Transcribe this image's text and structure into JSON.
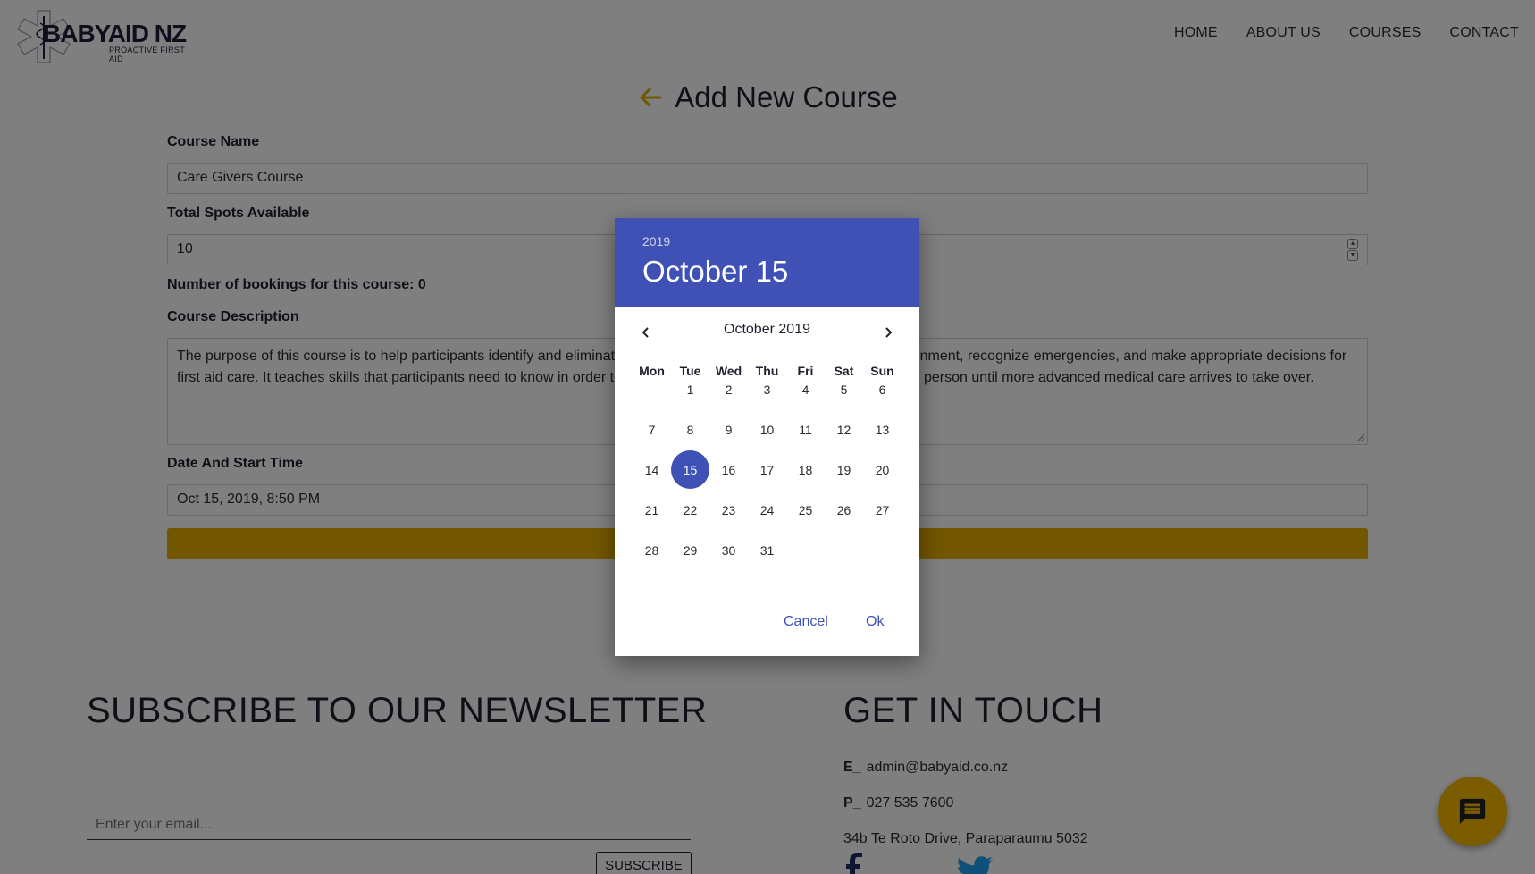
{
  "header": {
    "logo_text": "BABYAID NZ",
    "logo_tagline": "PROACTIVE FIRST AID",
    "nav": [
      "HOME",
      "ABOUT US",
      "COURSES",
      "CONTACT"
    ]
  },
  "page": {
    "title": "Add New Course"
  },
  "form": {
    "course_name_label": "Course Name",
    "course_name_value": "Care Givers Course",
    "spots_label": "Total Spots Available",
    "spots_value": "10",
    "bookings_text": "Number of bookings for this course: 0",
    "description_label": "Course Description",
    "description_value": "The purpose of this course is to help participants identify and eliminate potentially hazardous conditions in their environment, recognize emergencies, and make appropriate decisions for first aid care. It teaches skills that participants need to know in order to give immediate care to a suddenly ill or injured person until more advanced medical care arrives to take over.",
    "date_label": "Date And Start Time",
    "date_value": "Oct 15, 2019, 8:50 PM"
  },
  "footer": {
    "newsletter_heading": "SUBSCRIBE TO OUR NEWSLETTER",
    "email_placeholder": "Enter your email...",
    "subscribe_label": "SUBSCRIBE",
    "contact_heading": "GET IN TOUCH",
    "email_prefix": "E_",
    "email": "admin@babyaid.co.nz",
    "phone_prefix": "P_",
    "phone": "027 535 7600",
    "address": "34b Te Roto Drive, Paraparaumu 5032"
  },
  "datepicker": {
    "year": "2019",
    "selected_label": "October 15",
    "month_label": "October 2019",
    "weekdays": [
      "Mon",
      "Tue",
      "Wed",
      "Thu",
      "Fri",
      "Sat",
      "Sun"
    ],
    "days": [
      "1",
      "2",
      "3",
      "4",
      "5",
      "6",
      "7",
      "8",
      "9",
      "10",
      "11",
      "12",
      "13",
      "14",
      "15",
      "16",
      "17",
      "18",
      "19",
      "20",
      "21",
      "22",
      "23",
      "24",
      "25",
      "26",
      "27",
      "28",
      "29",
      "30",
      "31"
    ],
    "selected_day": "15",
    "cancel_label": "Cancel",
    "ok_label": "Ok"
  },
  "colors": {
    "accent_blue": "#3f51b5",
    "brand_yellow": "#e5ad00",
    "fab_yellow": "#f7b800"
  }
}
